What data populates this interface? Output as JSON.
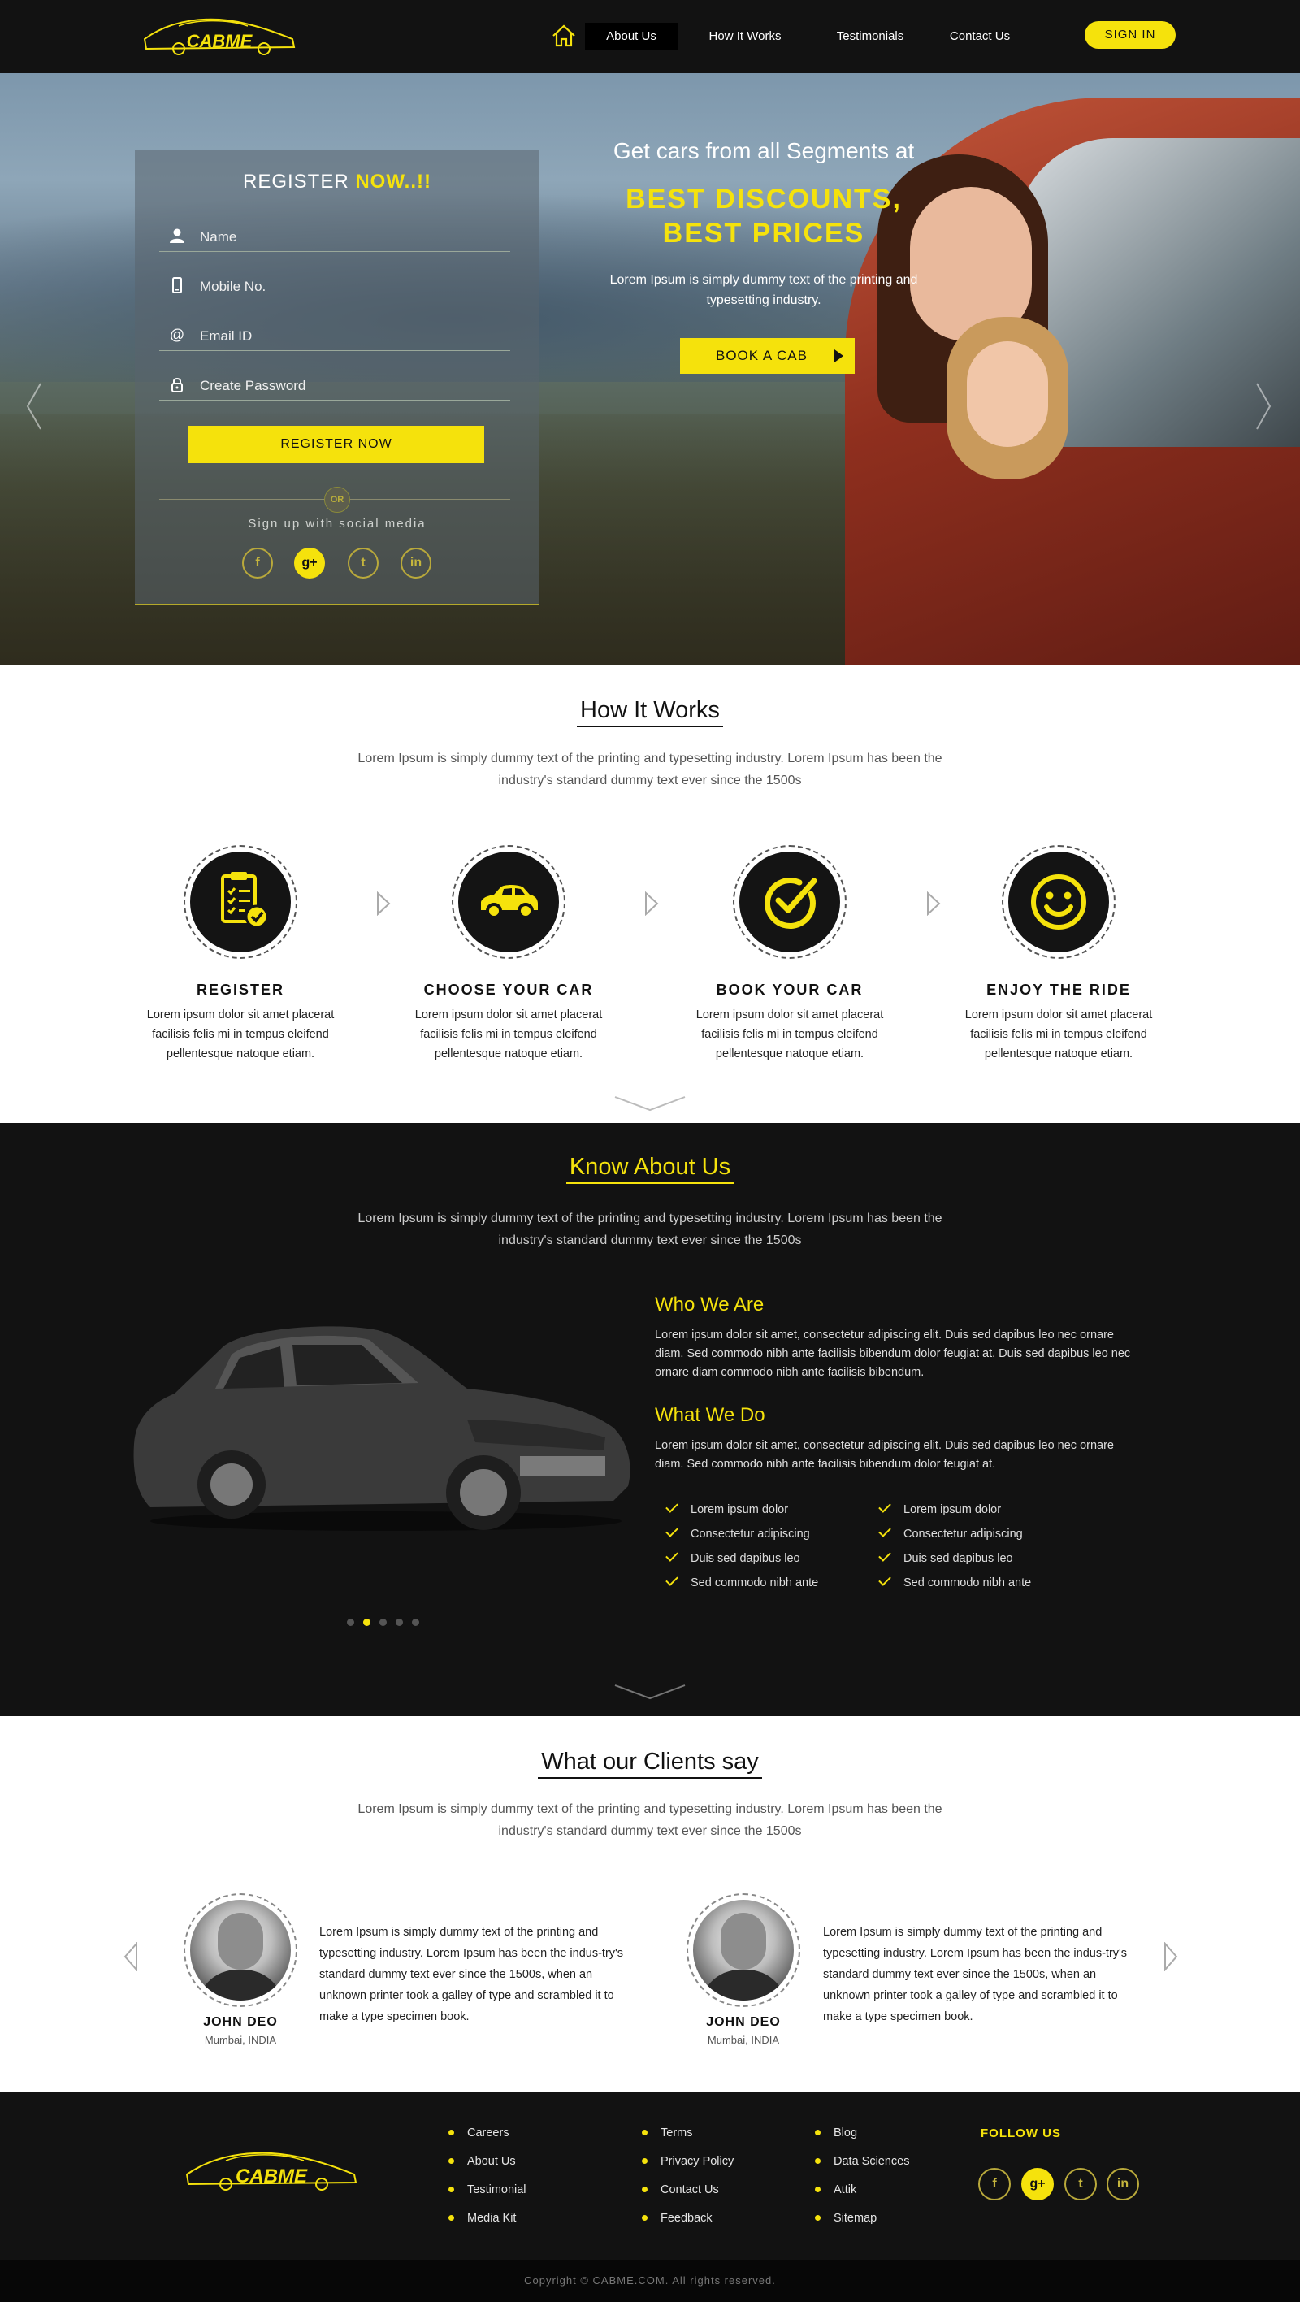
{
  "brand": {
    "name": "CABME"
  },
  "nav": {
    "items": [
      {
        "label": "About Us",
        "active": true
      },
      {
        "label": "How It Works",
        "active": false
      },
      {
        "label": "Testimonials",
        "active": false
      },
      {
        "label": "Contact Us",
        "active": false
      }
    ],
    "signin_label": "SIGN IN"
  },
  "register": {
    "title": "REGISTER",
    "title_highlight": "NOW..!!",
    "fields": [
      {
        "placeholder": "Name",
        "icon": "user-icon"
      },
      {
        "placeholder": "Mobile No.",
        "icon": "mobile-icon"
      },
      {
        "placeholder": "Email ID",
        "icon": "at-icon"
      },
      {
        "placeholder": "Create Password",
        "icon": "lock-icon"
      }
    ],
    "button_label": "REGISTER NOW",
    "or_label": "OR",
    "social_label": "Sign up with social media"
  },
  "hero": {
    "subtitle": "Get cars from all Segments at",
    "title_line1": "BEST DISCOUNTS,",
    "title_line2": "BEST PRICES",
    "description": "Lorem Ipsum is simply dummy text of the printing and typesetting industry.",
    "cta_label": "BOOK A CAB"
  },
  "how_it_works": {
    "title": "How It Works",
    "description": "Lorem Ipsum is simply dummy text of the printing and typesetting industry. Lorem Ipsum has been the industry's standard dummy text ever since the 1500s",
    "steps": [
      {
        "title": "REGISTER",
        "icon": "clipboard-check-icon",
        "text": "Lorem ipsum dolor sit amet placerat facilisis felis mi in tempus eleifend pellentesque natoque etiam."
      },
      {
        "title": "CHOOSE YOUR CAR",
        "icon": "car-icon",
        "text": "Lorem ipsum dolor sit amet placerat facilisis felis mi in tempus eleifend pellentesque natoque etiam."
      },
      {
        "title": "BOOK YOUR CAR",
        "icon": "check-circle-icon",
        "text": "Lorem ipsum dolor sit amet placerat facilisis felis mi in tempus eleifend pellentesque natoque etiam."
      },
      {
        "title": "ENJOY THE RIDE",
        "icon": "smiley-icon",
        "text": "Lorem ipsum dolor sit amet placerat facilisis felis mi in tempus eleifend pellentesque natoque etiam."
      }
    ]
  },
  "about": {
    "title": "Know About Us",
    "description": "Lorem Ipsum is simply dummy text of the printing and typesetting industry. Lorem Ipsum has been the industry's standard dummy text ever since the 1500s",
    "who_title": "Who We Are",
    "who_text": "Lorem ipsum dolor sit amet, consectetur adipiscing elit. Duis sed dapibus leo nec ornare diam. Sed commodo nibh ante facilisis bibendum dolor feugiat at. Duis sed dapibus leo nec ornare diam commodo nibh ante facilisis bibendum.",
    "what_title": "What We Do",
    "what_text": "Lorem ipsum dolor sit amet, consectetur adipiscing elit. Duis sed dapibus leo nec ornare diam. Sed commodo nibh ante facilisis bibendum dolor feugiat at.",
    "checklist_left": [
      "Lorem ipsum dolor",
      "Consectetur adipiscing",
      "Duis sed dapibus leo",
      "Sed commodo nibh ante"
    ],
    "checklist_right": [
      "Lorem ipsum dolor",
      "Consectetur adipiscing",
      "Duis sed dapibus leo",
      "Sed commodo nibh ante"
    ],
    "slider_dots": 5,
    "slider_active": 2
  },
  "testimonials": {
    "title": "What our Clients say",
    "description": "Lorem Ipsum is simply dummy text of the printing and typesetting industry. Lorem Ipsum has been the industry's standard dummy text ever since the 1500s",
    "items": [
      {
        "name": "JOHN DEO",
        "location": "Mumbai, INDIA",
        "text": "Lorem Ipsum is simply dummy text of the printing and typesetting industry. Lorem Ipsum has been the indus-try's standard dummy text ever since the 1500s, when an unknown printer took a galley of type and scrambled it to make a type specimen book."
      },
      {
        "name": "JOHN DEO",
        "location": "Mumbai, INDIA",
        "text": "Lorem Ipsum is simply dummy text of the printing and typesetting industry. Lorem Ipsum has been the indus-try's standard dummy text ever since the 1500s, when an unknown printer took a galley of type and scrambled it to make a type specimen book."
      }
    ]
  },
  "footer": {
    "col1": [
      "Careers",
      "About Us",
      "Testimonial",
      "Media Kit"
    ],
    "col2": [
      "Terms",
      "Privacy Policy",
      "Contact Us",
      "Feedback"
    ],
    "col3": [
      "Blog",
      "Data Sciences",
      "Attik",
      "Sitemap"
    ],
    "follow_label": "FOLLOW US",
    "copyright": "Copyright © CABME.COM. All rights reserved."
  },
  "social": [
    "f",
    "g+",
    "t",
    "in"
  ],
  "colors": {
    "accent": "#f5e20c",
    "dark": "#121212"
  }
}
